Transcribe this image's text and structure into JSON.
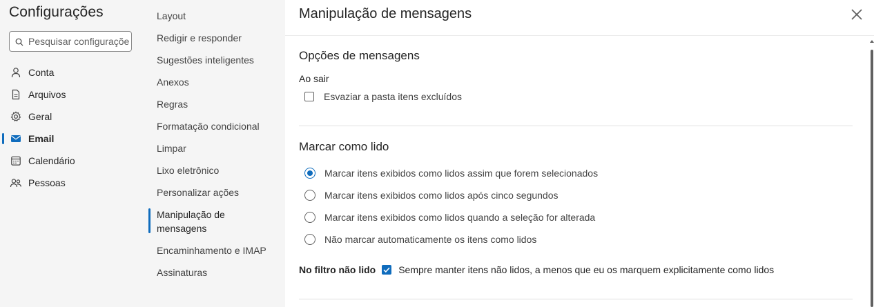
{
  "sidebar": {
    "title": "Configurações",
    "search_placeholder": "Pesquisar configuraçõe",
    "items": [
      {
        "label": "Conta",
        "icon": "person-icon"
      },
      {
        "label": "Arquivos",
        "icon": "document-icon"
      },
      {
        "label": "Geral",
        "icon": "gear-icon"
      },
      {
        "label": "Email",
        "icon": "mail-icon",
        "active": true
      },
      {
        "label": "Calendário",
        "icon": "calendar-icon"
      },
      {
        "label": "Pessoas",
        "icon": "people-icon"
      }
    ]
  },
  "subnav": {
    "items": [
      {
        "label": "Layout"
      },
      {
        "label": "Redigir e responder"
      },
      {
        "label": "Sugestões inteligentes"
      },
      {
        "label": "Anexos"
      },
      {
        "label": "Regras"
      },
      {
        "label": "Formatação condicional"
      },
      {
        "label": "Limpar"
      },
      {
        "label": "Lixo eletrônico"
      },
      {
        "label": "Personalizar ações"
      },
      {
        "label": "Manipulação de"
      },
      {
        "label": "mensagens"
      },
      {
        "label": "Encaminhamento e IMAP"
      },
      {
        "label": "Assinaturas"
      }
    ]
  },
  "main": {
    "title": "Manipulação de mensagens",
    "message_options": {
      "title": "Opções de mensagens",
      "on_exit_label": "Ao sair",
      "empty_deleted_label": "Esvaziar a pasta itens excluídos",
      "empty_deleted_checked": false
    },
    "mark_as_read": {
      "title": "Marcar como lido",
      "options": [
        {
          "label": "Marcar itens exibidos como lidos assim que forem selecionados",
          "selected": true
        },
        {
          "label": "Marcar itens exibidos como lidos após cinco segundos",
          "selected": false
        },
        {
          "label": "Marcar itens exibidos como lidos quando a seleção for alterada",
          "selected": false
        },
        {
          "label": "Não marcar automaticamente os itens como lidos",
          "selected": false
        }
      ]
    },
    "unread_filter": {
      "label": "No filtro não lido",
      "option_label": "Sempre manter itens não lidos, a menos que eu os marquem explicitamente como lidos",
      "checked": true
    }
  },
  "colors": {
    "accent": "#0f6cbd",
    "sidebar_bg": "#f5f5f5",
    "content_bg": "#ffffff"
  }
}
